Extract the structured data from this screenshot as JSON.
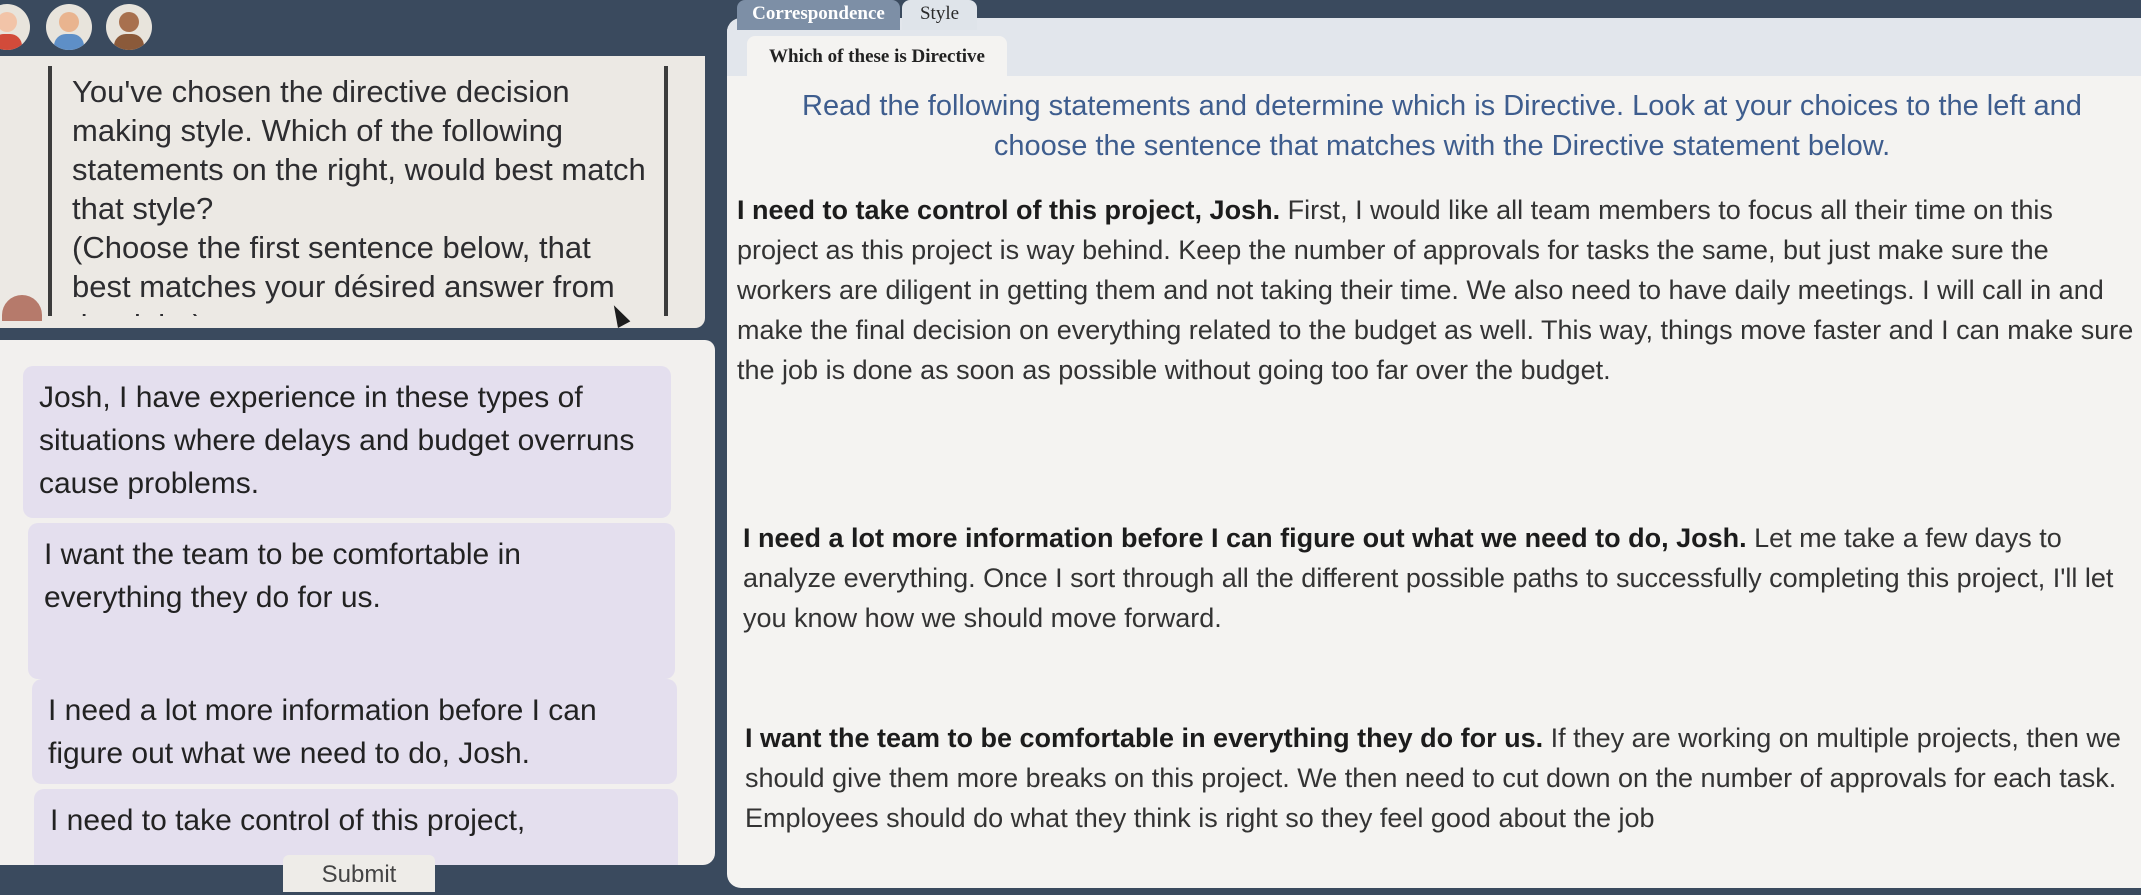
{
  "tabs": {
    "correspondence": "Correspondence",
    "style": "Style"
  },
  "sub_tab": "Which of these is Directive",
  "prompt": {
    "text": "You've chosen the directive decision making style. Which of the following statements on the right, would best match that style?\n(Choose the first sentence below,  that best matches your désired answer from the right.)"
  },
  "choices": [
    "Josh, I have experience in these types of situations where delays and budget overruns cause problems.",
    "I want the team to be comfortable in everything they do for us.",
    "I need a lot more information before I can figure out what we need to do, Josh.",
    "I need to take control of this project,"
  ],
  "submit_label": "Submit",
  "instructions": "Read the following statements and determine which is Directive. Look at your choices to the left and choose the sentence that matches with the Directive statement below.",
  "statements": [
    {
      "lead": "I need to take control of this project, Josh.",
      "body": " First, I would like all team members to focus all their time on this project as this project is way behind. Keep the number of approvals for tasks the same, but just make sure the workers are diligent in getting them and not taking their time. We also need to have daily meetings. I will call in and make the final decision on everything related to the budget as well. This way, things move faster and I can make sure the job is done as soon as possible without going too far over the budget."
    },
    {
      "lead": "I need a lot more information before I can figure out what we need to do, Josh.",
      "body": " Let me take a few days to analyze everything. Once I sort through all the different possible paths to successfully completing this project, I'll let you know how we should move forward."
    },
    {
      "lead": "I want the team to be comfortable in everything they do for us.",
      "body": " If they are working on multiple projects, then we should give them more breaks on this project. We then need to cut down on the number of approvals for each task. Employees should do what they think is right so they feel good about the job"
    }
  ],
  "colors": {
    "tab_active": "#7d8fa6",
    "instruction_text": "#3e5d8e",
    "choice_bg": "#e4dfee"
  }
}
